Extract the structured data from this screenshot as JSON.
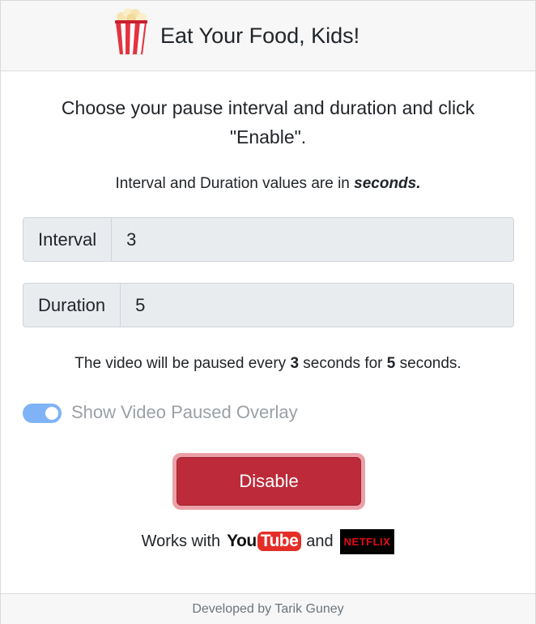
{
  "header": {
    "title": "Eat Your Food, Kids!",
    "logo_icon": "popcorn-icon"
  },
  "instructions": "Choose your pause interval and duration and click \"Enable\".",
  "units_note": {
    "prefix": "Interval and Duration values are in ",
    "emphasis": "seconds."
  },
  "interval": {
    "label": "Interval",
    "value": "3"
  },
  "duration": {
    "label": "Duration",
    "value": "5"
  },
  "summary": {
    "part1": "The video will be paused every ",
    "interval": "3",
    "part2": " seconds for ",
    "duration": "5",
    "part3": " seconds."
  },
  "overlay_toggle": {
    "label": "Show Video Paused Overlay",
    "checked": true,
    "color": "#80b3f6"
  },
  "disable_button": {
    "label": "Disable",
    "color": "#bd2b3a"
  },
  "works_with": {
    "prefix": "Works with",
    "youtube_you": "You",
    "youtube_tube": "Tube",
    "conjunction": "and",
    "netflix": "NETFLIX"
  },
  "footer": {
    "text": "Developed by Tarik Guney"
  }
}
